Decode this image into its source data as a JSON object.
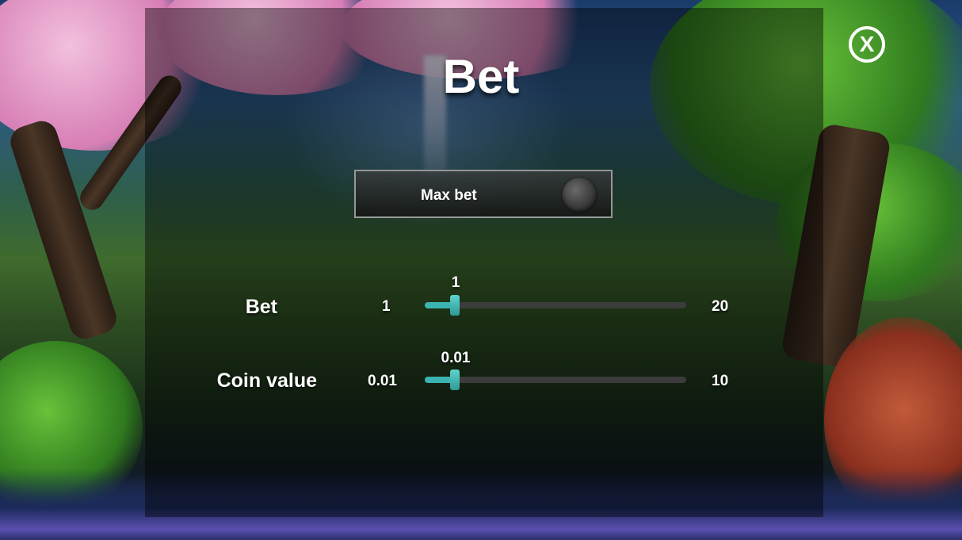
{
  "dialog": {
    "title": "Bet",
    "close_icon": "close-icon",
    "close_glyph": "X"
  },
  "max_bet": {
    "label": "Max bet",
    "enabled": false
  },
  "sliders": {
    "bet": {
      "label": "Bet",
      "min": "1",
      "max": "20",
      "value": "1",
      "fraction": 0
    },
    "coin_value": {
      "label": "Coin value",
      "min": "0.01",
      "max": "10",
      "value": "0.01",
      "fraction": 0
    }
  },
  "colors": {
    "accent": "#3bb4b1",
    "track": "#3c3c3c",
    "text": "#ffffff"
  }
}
